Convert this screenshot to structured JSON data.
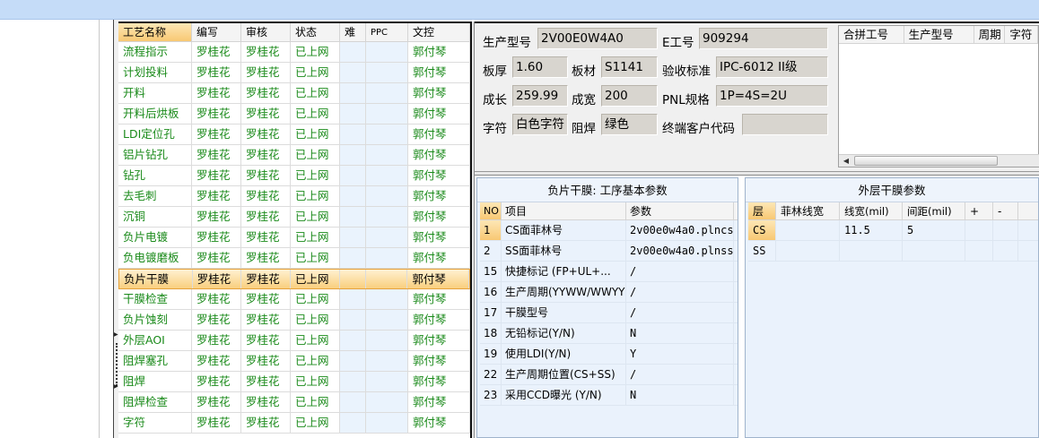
{
  "process_grid": {
    "columns": [
      "工艺名称",
      "编写",
      "审核",
      "状态",
      "难",
      "PPC",
      "文控"
    ],
    "rows": [
      {
        "name": "流程指示",
        "editor": "罗桂花",
        "reviewer": "罗桂花",
        "status": "已上网",
        "ctrl": "郭付琴"
      },
      {
        "name": "计划投料",
        "editor": "罗桂花",
        "reviewer": "罗桂花",
        "status": "已上网",
        "ctrl": "郭付琴"
      },
      {
        "name": "开料",
        "editor": "罗桂花",
        "reviewer": "罗桂花",
        "status": "已上网",
        "ctrl": "郭付琴"
      },
      {
        "name": "开料后烘板",
        "editor": "罗桂花",
        "reviewer": "罗桂花",
        "status": "已上网",
        "ctrl": "郭付琴"
      },
      {
        "name": "LDI定位孔",
        "editor": "罗桂花",
        "reviewer": "罗桂花",
        "status": "已上网",
        "ctrl": "郭付琴"
      },
      {
        "name": "铝片钻孔",
        "editor": "罗桂花",
        "reviewer": "罗桂花",
        "status": "已上网",
        "ctrl": "郭付琴"
      },
      {
        "name": "钻孔",
        "editor": "罗桂花",
        "reviewer": "罗桂花",
        "status": "已上网",
        "ctrl": "郭付琴"
      },
      {
        "name": "去毛刺",
        "editor": "罗桂花",
        "reviewer": "罗桂花",
        "status": "已上网",
        "ctrl": "郭付琴"
      },
      {
        "name": "沉铜",
        "editor": "罗桂花",
        "reviewer": "罗桂花",
        "status": "已上网",
        "ctrl": "郭付琴"
      },
      {
        "name": "负片电镀",
        "editor": "罗桂花",
        "reviewer": "罗桂花",
        "status": "已上网",
        "ctrl": "郭付琴"
      },
      {
        "name": "负电镀磨板",
        "editor": "罗桂花",
        "reviewer": "罗桂花",
        "status": "已上网",
        "ctrl": "郭付琴"
      },
      {
        "name": "负片干膜",
        "editor": "罗桂花",
        "reviewer": "罗桂花",
        "status": "已上网",
        "ctrl": "郭付琴"
      },
      {
        "name": "干膜检查",
        "editor": "罗桂花",
        "reviewer": "罗桂花",
        "status": "已上网",
        "ctrl": "郭付琴"
      },
      {
        "name": "负片蚀刻",
        "editor": "罗桂花",
        "reviewer": "罗桂花",
        "status": "已上网",
        "ctrl": "郭付琴"
      },
      {
        "name": "外层AOI",
        "editor": "罗桂花",
        "reviewer": "罗桂花",
        "status": "已上网",
        "ctrl": "郭付琴"
      },
      {
        "name": "阻焊塞孔",
        "editor": "罗桂花",
        "reviewer": "罗桂花",
        "status": "已上网",
        "ctrl": "郭付琴"
      },
      {
        "name": "阻焊",
        "editor": "罗桂花",
        "reviewer": "罗桂花",
        "status": "已上网",
        "ctrl": "郭付琴"
      },
      {
        "name": "阻焊检查",
        "editor": "罗桂花",
        "reviewer": "罗桂花",
        "status": "已上网",
        "ctrl": "郭付琴"
      },
      {
        "name": "字符",
        "editor": "罗桂花",
        "reviewer": "罗桂花",
        "status": "已上网",
        "ctrl": "郭付琴"
      }
    ],
    "selected_index": 11
  },
  "info": {
    "model_label": "生产型号",
    "model_value": "2V00E0W4A0",
    "eno_label": "E工号",
    "eno_value": "909294",
    "thickness_label": "板厚",
    "thickness_value": "1.60",
    "material_label": "板材",
    "material_value": "S1141",
    "standard_label": "验收标准",
    "standard_value": "IPC-6012 II级",
    "length_label": "成长",
    "length_value": "259.99",
    "width_label": "成宽",
    "width_value": "200",
    "pnl_label": "PNL规格",
    "pnl_value": "1P=4S=2U",
    "legend_label": "字符",
    "legend_value": "白色字符",
    "mask_label": "阻焊",
    "mask_value": "绿色",
    "customer_label": "终端客户代码",
    "customer_value": ""
  },
  "merge_grid": {
    "columns": [
      "合拼工号",
      "生产型号",
      "周期",
      "字符"
    ]
  },
  "film_panel": {
    "title": "负片干膜: 工序基本参数",
    "columns": [
      "NO",
      "项目",
      "参数"
    ],
    "rows": [
      {
        "no": "1",
        "item": "CS面菲林号",
        "param": "2v00e0w4a0.plncs"
      },
      {
        "no": "2",
        "item": "SS面菲林号",
        "param": "2v00e0w4a0.plnss"
      },
      {
        "no": "15",
        "item": "快捷标记 (FP+UL+...",
        "param": "/"
      },
      {
        "no": "16",
        "item": "生产周期(YYWW/WWYY)",
        "param": "/"
      },
      {
        "no": "17",
        "item": "干膜型号",
        "param": "/"
      },
      {
        "no": "18",
        "item": "无铅标记(Y/N)",
        "param": "N"
      },
      {
        "no": "19",
        "item": "使用LDI(Y/N)",
        "param": "Y"
      },
      {
        "no": "22",
        "item": "生产周期位置(CS+SS)",
        "param": "/"
      },
      {
        "no": "23",
        "item": "采用CCD曝光 (Y/N)",
        "param": "N"
      }
    ]
  },
  "outer_panel": {
    "title": "外层干膜参数",
    "columns": [
      "层",
      "菲林线宽",
      "线宽(mil)",
      "间距(mil)",
      "+",
      "-"
    ],
    "rows": [
      {
        "layer": "CS",
        "film": "",
        "width": "11.5",
        "gap": "5"
      },
      {
        "layer": "SS",
        "film": "",
        "width": "",
        "gap": ""
      }
    ]
  },
  "colors": {
    "row_text": "#1a8a1a",
    "selection": "#f8c873",
    "panel_bg": "#eaf2fc",
    "titlebar": "#c5dcf8"
  }
}
